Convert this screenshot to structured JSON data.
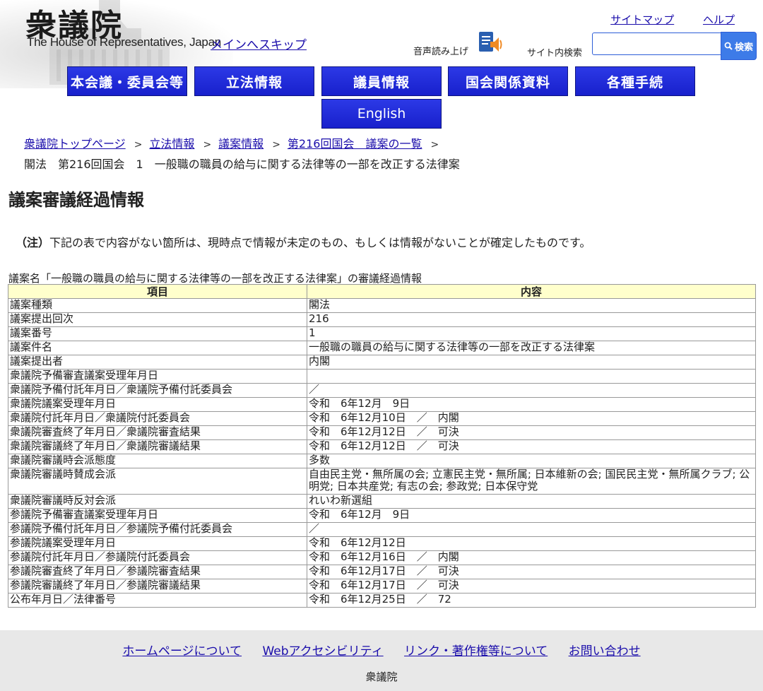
{
  "header": {
    "logo_kanji": "衆議院",
    "logo_en": "The House of Representatives, Japan",
    "skip_link": "メインへスキップ",
    "sitemap": "サイトマップ",
    "help": "ヘルプ",
    "voice_label": "音声読み上げ",
    "search_label": "サイト内検索",
    "search_placeholder": "",
    "search_button": "検索"
  },
  "nav": {
    "items": [
      "本会議・委員会等",
      "立法情報",
      "議員情報",
      "国会関係資料",
      "各種手続"
    ],
    "english": "English"
  },
  "breadcrumb": {
    "items": [
      "衆議院トップページ",
      "立法情報",
      "議案情報",
      "第216回国会　議案の一覧"
    ],
    "separator": ">",
    "current": "閣法　第216回国会　1　一般職の職員の給与に関する法律等の一部を改正する法律案"
  },
  "page_title": "議案審議経過情報",
  "note": {
    "label": "（注）",
    "text": "下記の表で内容がない箇所は、現時点で情報が未定のもの、もしくは情報がないことが確定したものです。"
  },
  "table": {
    "caption": "議案名「一般職の職員の給与に関する法律等の一部を改正する法律案」の審議経過情報",
    "headers": [
      "項目",
      "内容"
    ],
    "rows": [
      [
        "議案種類",
        "閣法"
      ],
      [
        "議案提出回次",
        "216"
      ],
      [
        "議案番号",
        "1"
      ],
      [
        "議案件名",
        "一般職の職員の給与に関する法律等の一部を改正する法律案"
      ],
      [
        "議案提出者",
        "内閣"
      ],
      [
        "衆議院予備審査議案受理年月日",
        ""
      ],
      [
        "衆議院予備付託年月日／衆議院予備付託委員会",
        "／"
      ],
      [
        "衆議院議案受理年月日",
        "令和　6年12月　9日"
      ],
      [
        "衆議院付託年月日／衆議院付託委員会",
        "令和　6年12月10日　／　内閣"
      ],
      [
        "衆議院審査終了年月日／衆議院審査結果",
        "令和　6年12月12日　／　可決"
      ],
      [
        "衆議院審議終了年月日／衆議院審議結果",
        "令和　6年12月12日　／　可決"
      ],
      [
        "衆議院審議時会派態度",
        "多数"
      ],
      [
        "衆議院審議時賛成会派",
        "自由民主党・無所属の会; 立憲民主党・無所属; 日本維新の会; 国民民主党・無所属クラブ; 公明党; 日本共産党; 有志の会; 参政党; 日本保守党"
      ],
      [
        "衆議院審議時反対会派",
        "れいわ新選組"
      ],
      [
        "参議院予備審査議案受理年月日",
        "令和　6年12月　9日"
      ],
      [
        "参議院予備付託年月日／参議院予備付託委員会",
        "／"
      ],
      [
        "参議院議案受理年月日",
        "令和　6年12月12日"
      ],
      [
        "参議院付託年月日／参議院付託委員会",
        "令和　6年12月16日　／　内閣"
      ],
      [
        "参議院審査終了年月日／参議院審査結果",
        "令和　6年12月17日　／　可決"
      ],
      [
        "参議院審議終了年月日／参議院審議結果",
        "令和　6年12月17日　／　可決"
      ],
      [
        "公布年月日／法律番号",
        "令和　6年12月25日　／　72"
      ]
    ]
  },
  "footer": {
    "links": [
      "ホームページについて",
      "Webアクセシビリティ",
      "リンク・著作権等について",
      "お問い合わせ"
    ],
    "org": "衆議院"
  },
  "colors": {
    "nav_bg": "#1f2ad8",
    "table_header_bg": "#ffffcc",
    "link": "#1a0dab",
    "footer_bg": "#e8e8e8"
  }
}
